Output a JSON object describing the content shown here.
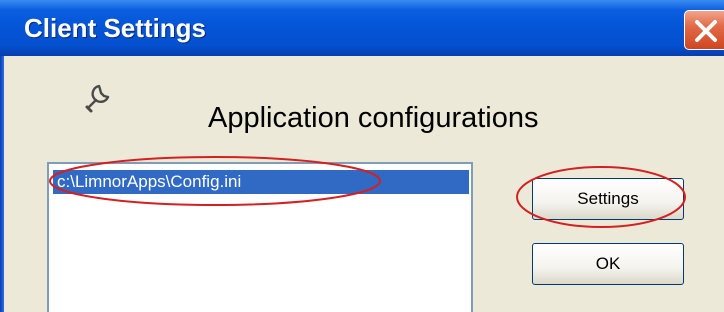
{
  "window": {
    "title": "Client Settings",
    "close_icon": "close-icon"
  },
  "header": {
    "icon": "wrench-icon",
    "heading": "Application configurations"
  },
  "config_list": {
    "items": [
      {
        "label": "c:\\LimnorApps\\Config.ini",
        "selected": true
      }
    ]
  },
  "buttons": {
    "settings_label": "Settings",
    "ok_label": "OK"
  },
  "colors": {
    "titlebar": "#0454d6",
    "selection": "#316ac5",
    "dialog_background": "#ece9d8",
    "annotation": "#d42020"
  }
}
